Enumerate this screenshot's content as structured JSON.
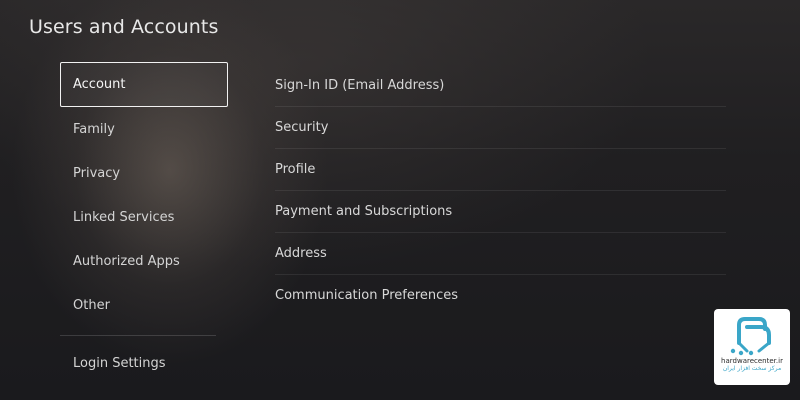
{
  "header": {
    "title": "Users and Accounts"
  },
  "sidebar": {
    "selected_index": 0,
    "items": [
      {
        "label": "Account"
      },
      {
        "label": "Family"
      },
      {
        "label": "Privacy"
      },
      {
        "label": "Linked Services"
      },
      {
        "label": "Authorized Apps"
      },
      {
        "label": "Other"
      }
    ],
    "bottom_items": [
      {
        "label": "Login Settings"
      }
    ]
  },
  "content": {
    "items": [
      {
        "label": "Sign-In ID (Email Address)"
      },
      {
        "label": "Security"
      },
      {
        "label": "Profile"
      },
      {
        "label": "Payment and Subscriptions"
      },
      {
        "label": "Address"
      },
      {
        "label": "Communication Preferences"
      }
    ]
  },
  "watermark": {
    "brand": "hardwarecenter.ir",
    "tagline": "مرکز سخت افزار ایران",
    "accent_color": "#3aa6c8"
  }
}
